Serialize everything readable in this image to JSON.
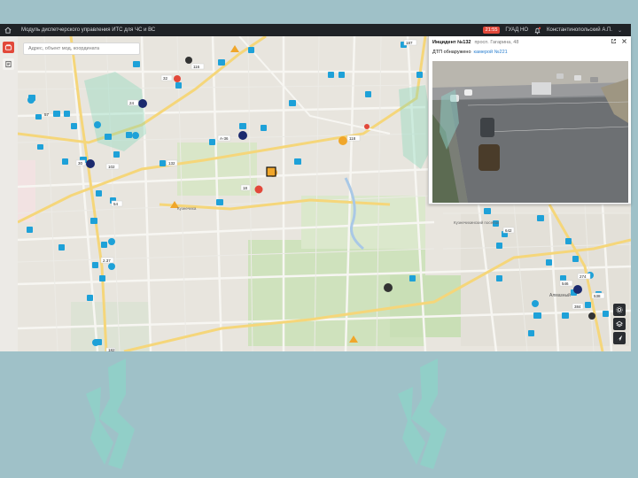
{
  "header": {
    "title": "Модуль диспетчерского управления ИТС для ЧС и ВС",
    "status_badge": "21:55",
    "org": "ГУАД НО",
    "user": "Константинопольский А.П."
  },
  "search": {
    "placeholder": "Адрес, объект мод, координата"
  },
  "incident": {
    "title": "Инцидент №132",
    "address": "просп. Гагарина, 48",
    "event": "ДТП обнаружено",
    "camera": "камерой №221"
  },
  "map_labels": {
    "l1": "116",
    "l2": "32",
    "l3": "24",
    "l4": "А-36",
    "l5": "118",
    "l6": "30",
    "l7": "102",
    "l8": "132",
    "l9": "18",
    "l10": "54",
    "l11": "2.37",
    "l12": "182",
    "l13": "187",
    "l14": "642",
    "l15": "274",
    "l16": "546",
    "l17": "384",
    "l18": "538",
    "l19": "57",
    "l20": "Алмазный",
    "l21": "Кузнечихинский поселок",
    "l22": "Кузнечиха"
  },
  "colors": {
    "accent": "#1ea1d8",
    "topbar": "#1f2226",
    "watermark": "#8fd2c8",
    "alert": "#e2483a"
  }
}
